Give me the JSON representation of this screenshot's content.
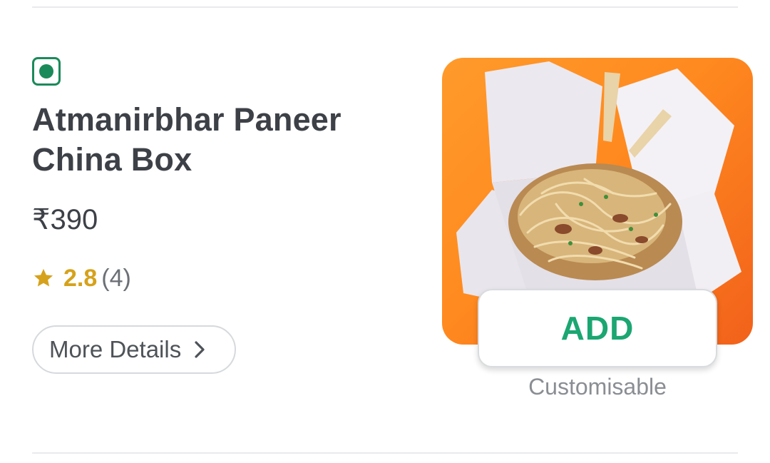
{
  "item": {
    "veg_indicator": "veg-icon",
    "name": "Atmanirbhar Paneer China Box",
    "price": "₹390",
    "rating": {
      "value": "2.8",
      "count": "(4)",
      "icon": "star-icon"
    },
    "more_details_label": "More Details",
    "add_label": "ADD",
    "customisable_label": "Customisable"
  },
  "colors": {
    "veg_green": "#1b8a5a",
    "add_green": "#1ba672",
    "rating_gold": "#d6a21b",
    "image_orange": "#ff8a1f"
  }
}
